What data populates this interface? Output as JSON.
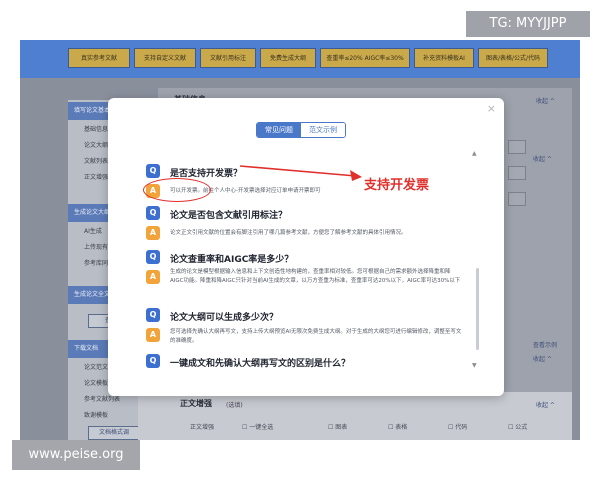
{
  "watermarks": {
    "top_right": "TG: MYYJJPP",
    "bottom_left": "www.peise.org"
  },
  "topbar": {
    "chips": [
      "真实参考文献",
      "支持自定义文献",
      "文献引用标注",
      "免费生成大纲",
      "查重率≤20% AIGC率≤30%",
      "补充资料模板AI",
      "图表/表格/公式/代码"
    ]
  },
  "sidebar": {
    "sections": [
      {
        "title": "填写论文基本",
        "items": [
          "基础信息",
          "论文大纲",
          "文献列表",
          "正文增强"
        ]
      },
      {
        "title": "生成论文大纲",
        "items": [
          "AI生成",
          "上传现有",
          "参考库同"
        ]
      },
      {
        "title": "生成论文全文",
        "items": [],
        "button": "查看"
      },
      {
        "title": "下载文档",
        "items": [
          "论文范文",
          "论文模板",
          "参考文献列表",
          "致谢模板"
        ],
        "button": "文档格式调"
      }
    ]
  },
  "background": {
    "section_title": "基础信息",
    "collapse": "收起 ^",
    "example_link": "查看示例",
    "section_title_2": "正文增强",
    "section_title_2_sub": "(选填)",
    "options_label": "正文增强",
    "options": [
      "一键全选",
      "图表",
      "表格",
      "代码",
      "公式"
    ]
  },
  "modal": {
    "close_symbol": "×",
    "tabs": [
      {
        "label": "常见问题",
        "active": true
      },
      {
        "label": "范文示例",
        "active": false
      }
    ],
    "faq": [
      {
        "q": "是否支持开发票？",
        "a": "可以开发票。前往个人中心-开发票选择对应订单申请开票即可"
      },
      {
        "q": "论文是否包含文献引用标注？",
        "a": "论文正文引用文献的位置会有脚注引用了哪几篇参考文献，方便您了解参考文献的具体引用情况。"
      },
      {
        "q": "论文查重率和AIGC率是多少？",
        "a": "生成的论文是模型根据输入信息和上下文创造性地构建的，查重率相对较低。您可根据自己的需求额外选择降重和降AIGC功能。降重和降AIGC只针对当前AI生成的文章，以万方查重为标准，查重率可达20%以下，AIGC率可达30%以下"
      },
      {
        "q": "论文大纲可以生成多少次？",
        "a": "您可选择先确认大纲再写文，支持上传大纲预览AI无限次免费生成大纲。对于生成的大纲您可进行编辑修改，调整至写文的准确度。"
      },
      {
        "q": "一键成文和先确认大纲再写文的区别是什么？",
        "a": ""
      }
    ],
    "scroll": {
      "up": "▲",
      "down": "▼"
    }
  },
  "annotation": {
    "label": "支持开发票",
    "color": "#e0302c"
  },
  "colors": {
    "primary": "#4a78c8",
    "q_badge": "#3c6fd0",
    "a_badge": "#f2a33a",
    "topbar": "#4f7fd0",
    "chip": "#c9a94a"
  }
}
